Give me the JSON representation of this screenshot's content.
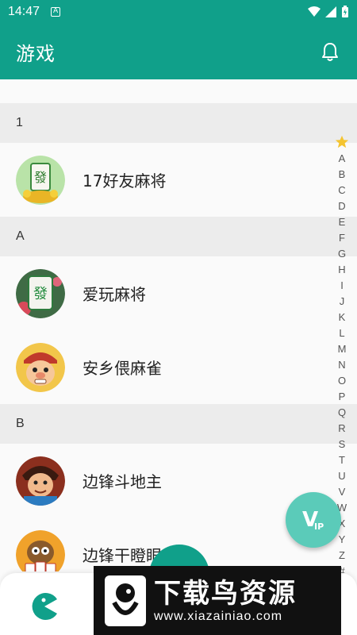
{
  "status_bar": {
    "time": "14:47",
    "notification_glyph": "A"
  },
  "app_bar": {
    "title": "游戏",
    "icon": "bell-icon"
  },
  "sections": [
    {
      "header": "1",
      "items": [
        {
          "name": "17好友麻将",
          "icon": "mahjong-fa-tile-icon"
        }
      ]
    },
    {
      "header": "A",
      "items": [
        {
          "name": "爱玩麻将",
          "icon": "mahjong-tile-icon"
        },
        {
          "name": "安乡偎麻雀",
          "icon": "cartoon-face-icon"
        }
      ]
    },
    {
      "header": "B",
      "items": [
        {
          "name": "边锋斗地主",
          "icon": "cartoon-character-icon"
        },
        {
          "name": "边锋干瞪眼",
          "icon": "cartoon-cards-icon"
        }
      ]
    }
  ],
  "index_bar": {
    "star": "★",
    "letters": [
      "A",
      "B",
      "C",
      "D",
      "E",
      "F",
      "G",
      "H",
      "I",
      "J",
      "K",
      "L",
      "M",
      "N",
      "O",
      "P",
      "Q",
      "R",
      "S",
      "T",
      "U",
      "V",
      "W",
      "X",
      "Y",
      "Z",
      "#"
    ]
  },
  "vip_button": {
    "label": "V",
    "sub": "IP"
  },
  "watermark": {
    "title": "下载鸟资源",
    "url": "www.xiazainiao.com"
  },
  "colors": {
    "primary": "#10a08a",
    "vip": "#5bcbb9",
    "header_bg": "#ececec"
  }
}
